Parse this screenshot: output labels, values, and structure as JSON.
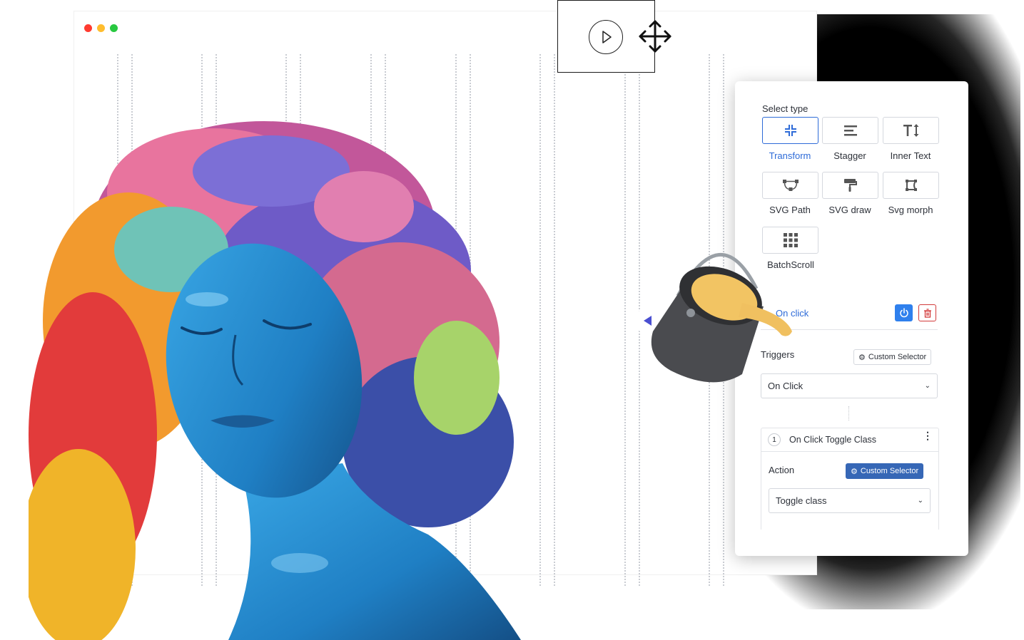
{
  "window": {
    "traffic_lights": [
      "#ff3b30",
      "#ffbd2e",
      "#28c840"
    ]
  },
  "video": {
    "play_icon": "play-icon",
    "move_icon": "move-arrows-icon"
  },
  "panel": {
    "select_type_label": "Select type",
    "types": [
      {
        "label": "Transform",
        "icon": "compress-icon",
        "active": true
      },
      {
        "label": "Stagger",
        "icon": "stagger-lines-icon",
        "active": false
      },
      {
        "label": "Inner Text",
        "icon": "text-height-icon",
        "active": false
      },
      {
        "label": "SVG Path",
        "icon": "bezier-path-icon",
        "active": false
      },
      {
        "label": "SVG draw",
        "icon": "paint-roller-icon",
        "active": false
      },
      {
        "label": "Svg morph",
        "icon": "morph-shape-icon",
        "active": false
      },
      {
        "label": "BatchScroll",
        "icon": "grid-icon",
        "active": false
      }
    ],
    "event": {
      "label": "On click",
      "power_icon": "power-icon",
      "delete_icon": "trash-icon"
    },
    "triggers_label": "Triggers",
    "custom_selector": "Custom Selector",
    "trigger_value": "On Click",
    "action_item": {
      "index": "1",
      "title": "On Click Toggle Class"
    },
    "action_label": "Action",
    "action_custom_selector": "Custom Selector",
    "action_value": "Toggle class",
    "accent": "#2e6bd8",
    "danger": "#d23b3b"
  }
}
